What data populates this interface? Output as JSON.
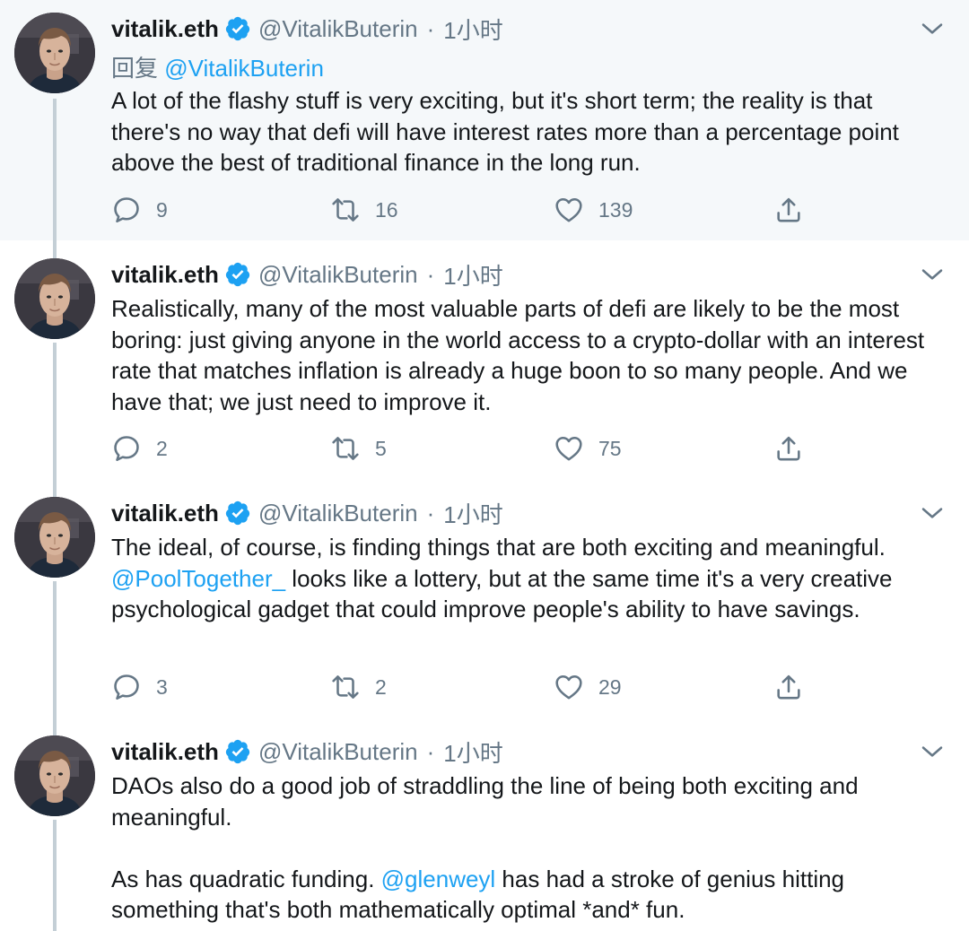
{
  "colors": {
    "link": "#1da1f2",
    "secondary_text": "#657786",
    "primary_text": "#14171a",
    "thread_line": "#c4cfd6",
    "highlight_background": "#f5f8fa"
  },
  "icons": {
    "verified": "verified-badge-icon",
    "caret": "chevron-down-icon",
    "reply": "reply-bubble-icon",
    "retweet": "retweet-arrows-icon",
    "like": "heart-icon",
    "share": "share-upload-icon"
  },
  "tweets": [
    {
      "name": "vitalik.eth",
      "handle": "@VitalikButerin",
      "separator": "·",
      "time": "1小时",
      "reply_prefix": "回复",
      "reply_to": "@VitalikButerin",
      "text": "A lot of the flashy stuff is very exciting, but it's short term; the reality is that there's no way that defi will have interest rates more than a percentage point above the best of traditional finance in the long run.",
      "replies": "9",
      "retweets": "16",
      "likes": "139"
    },
    {
      "name": "vitalik.eth",
      "handle": "@VitalikButerin",
      "separator": "·",
      "time": "1小时",
      "text": "Realistically, many of the most valuable parts of defi are likely to be the most boring: just giving anyone in the world access to a crypto-dollar with an interest rate that matches inflation is already a huge boon to so many people. And we have that; we just need to improve it.",
      "replies": "2",
      "retweets": "5",
      "likes": "75"
    },
    {
      "name": "vitalik.eth",
      "handle": "@VitalikButerin",
      "separator": "·",
      "time": "1小时",
      "text_before": "The ideal, of course, is finding things that are both exciting and meaningful. ",
      "mention": "@PoolTogether_",
      "text_after": " looks like a lottery, but at the same time it's a very creative psychological gadget that could improve people's ability to have savings.",
      "replies": "3",
      "retweets": "2",
      "likes": "29"
    },
    {
      "name": "vitalik.eth",
      "handle": "@VitalikButerin",
      "separator": "·",
      "time": "1小时",
      "paragraph1": "DAOs also do a good job of straddling the line of being both exciting and meaningful.",
      "p2_before": "As has quadratic funding. ",
      "mention": "@glenweyl",
      "p2_after": " has had a stroke of genius hitting something that's both mathematically optimal *and* fun."
    }
  ]
}
